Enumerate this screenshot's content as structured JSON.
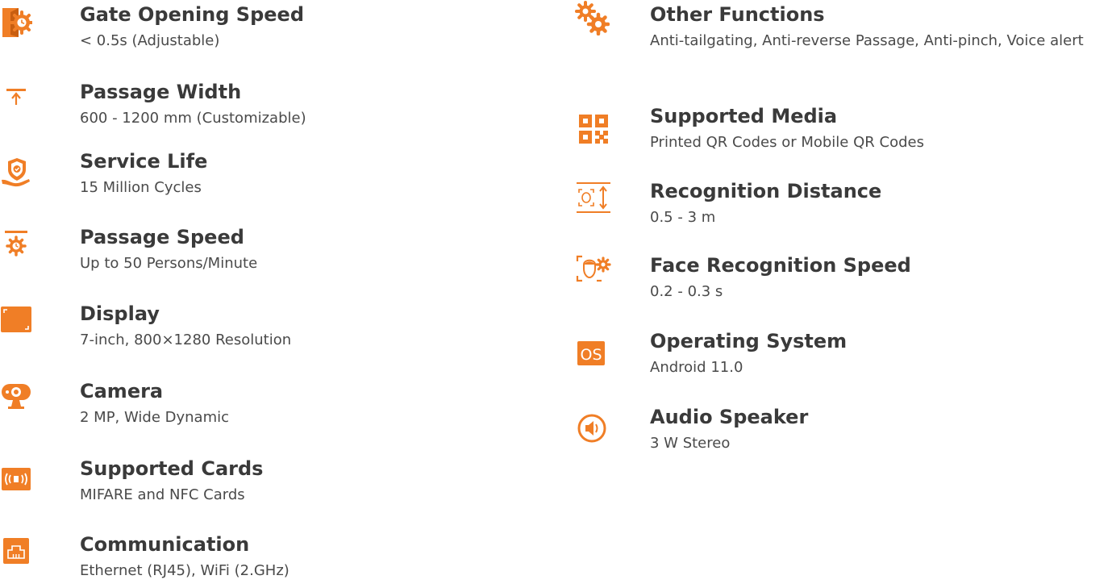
{
  "accent_color": "#F07E26",
  "left_specs": [
    {
      "icon": "gate-door-gear-icon",
      "title": "Gate Opening Speed",
      "value": "< 0.5s (Adjustable)"
    },
    {
      "icon": "passage-width-icon",
      "title": "Passage Width",
      "value": "600 - 1200 mm (Customizable)"
    },
    {
      "icon": "shield-hand-icon",
      "title": "Service Life",
      "value": "15 Million Cycles"
    },
    {
      "icon": "gear-timer-icon",
      "title": "Passage Speed",
      "value": "Up to 50 Persons/Minute"
    },
    {
      "icon": "display-screen-icon",
      "title": "Display",
      "value": "7-inch, 800×1280 Resolution"
    },
    {
      "icon": "webcam-icon",
      "title": "Camera",
      "value": "2 MP, Wide Dynamic"
    },
    {
      "icon": "rfid-card-icon",
      "title": "Supported Cards",
      "value": "MIFARE and NFC Cards"
    },
    {
      "icon": "ethernet-port-icon",
      "title": "Communication",
      "value": "Ethernet (RJ45), WiFi (2.GHz)"
    }
  ],
  "right_specs": [
    {
      "icon": "gears-icon",
      "title": "Other Functions",
      "value": "Anti-tailgating, Anti-reverse Passage, Anti-pinch, Voice alert"
    },
    {
      "icon": "qr-code-icon",
      "title": "Supported Media",
      "value": "Printed QR Codes or Mobile QR Codes"
    },
    {
      "icon": "face-distance-icon",
      "title": "Recognition Distance",
      "value": "0.5 - 3 m"
    },
    {
      "icon": "face-scan-gear-icon",
      "title": "Face Recognition Speed",
      "value": "0.2 - 0.3 s"
    },
    {
      "icon": "os-badge-icon",
      "title": "Operating System",
      "value": "Android 11.0",
      "badge_text": "OS"
    },
    {
      "icon": "speaker-icon",
      "title": "Audio Speaker",
      "value": "3 W Stereo"
    }
  ]
}
